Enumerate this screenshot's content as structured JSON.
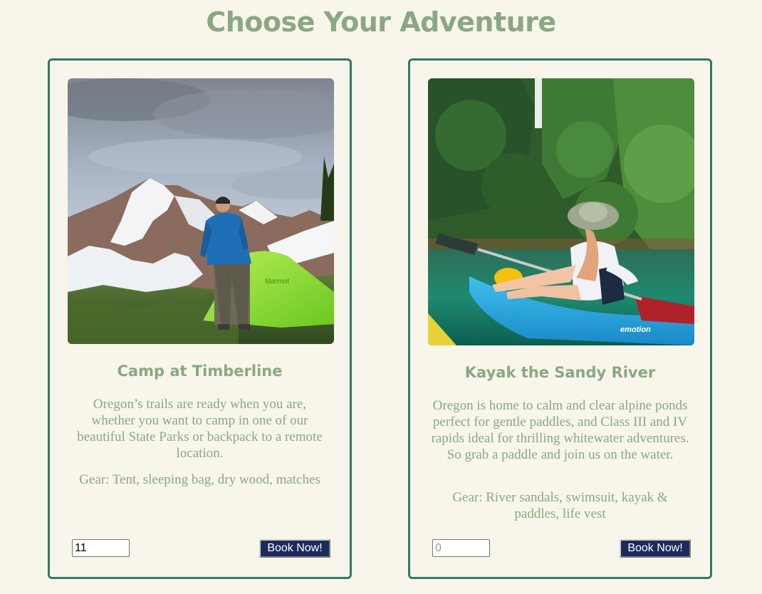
{
  "page": {
    "title": "Choose Your Adventure"
  },
  "cards": [
    {
      "title": "Camp at Timberline",
      "description": "Oregon’s trails are ready when you are, whether you want to camp in one of our beautiful State Parks or backpack to a remote location.",
      "gear": "Gear: Tent, sleeping bag, dry wood, matches",
      "quantity_value": "11",
      "quantity_placeholder": "0",
      "button_label": "Book Now!",
      "tent_brand": "Marmot"
    },
    {
      "title": "Kayak the Sandy River",
      "description": "Oregon is home to calm and clear alpine ponds perfect for gentle paddles, and Class III and IV rapids ideal for thrilling whitewater adventures. So grab a paddle and join us on the water.",
      "gear": "Gear: River sandals, swimsuit, kayak & paddles, life vest",
      "quantity_value": "",
      "quantity_placeholder": "0",
      "button_label": "Book Now!",
      "kayak_brand": "emotion"
    }
  ],
  "colors": {
    "background": "#f8f5ea",
    "heading": "#8aa882",
    "card_border": "#2e7b68",
    "button_bg": "#1b2b5c"
  }
}
